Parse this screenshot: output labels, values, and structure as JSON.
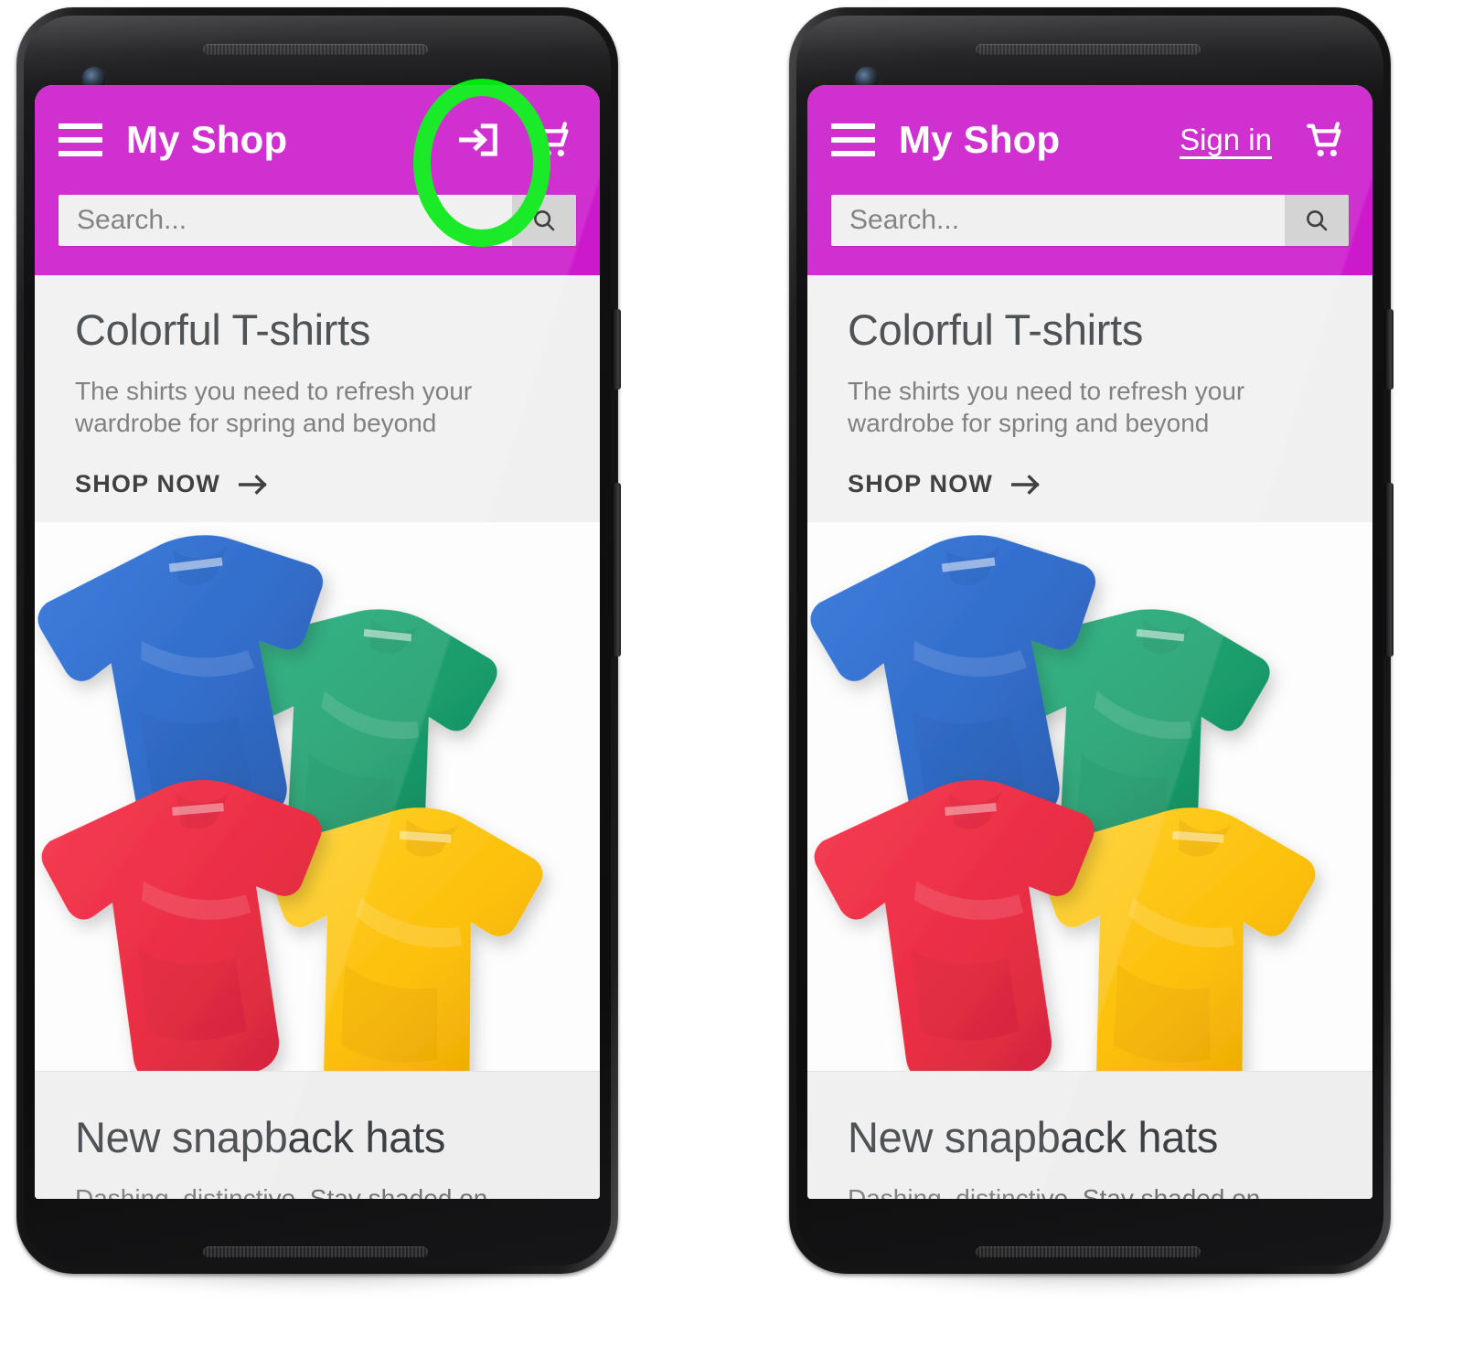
{
  "meta": {
    "accent_magenta": "#cc19cc",
    "highlight_green": "#00e810",
    "screen_bg": "#eeeeee"
  },
  "phones": [
    {
      "id": "left",
      "variant": "icon",
      "appbar": {
        "menu_icon": "hamburger-menu-icon",
        "title": "My Shop",
        "auth_icon": "login-arrow-icon",
        "auth_label": "",
        "cart_icon": "shopping-cart-icon"
      },
      "search": {
        "placeholder": "Search...",
        "value": "",
        "button_icon": "search-icon"
      },
      "hero": {
        "title": "Colorful T-shirts",
        "subtitle": "The shirts you need to refresh your wardrobe for spring and beyond",
        "cta_label": "SHOP NOW",
        "cta_icon": "arrow-right-icon"
      },
      "second_card": {
        "title": "New snapback hats",
        "subtitle": "Dashing, distinctive. Stay shaded on sunny"
      },
      "highlight": "login-arrow-icon"
    },
    {
      "id": "right",
      "variant": "text",
      "appbar": {
        "menu_icon": "hamburger-menu-icon",
        "title": "My Shop",
        "auth_icon": "",
        "auth_label": "Sign in",
        "cart_icon": "shopping-cart-icon"
      },
      "search": {
        "placeholder": "Search...",
        "value": "",
        "button_icon": "search-icon"
      },
      "hero": {
        "title": "Colorful T-shirts",
        "subtitle": "The shirts you need to refresh your wardrobe for spring and beyond",
        "cta_label": "SHOP NOW",
        "cta_icon": "arrow-right-icon"
      },
      "second_card": {
        "title": "New snapback hats",
        "subtitle": "Dashing, distinctive. Stay shaded on sunny"
      },
      "highlight": "sign-in-link"
    }
  ],
  "product_photo": {
    "alt": "Four folded t-shirts",
    "shirts": [
      {
        "color_name": "blue",
        "hex": "#1b5cc4"
      },
      {
        "color_name": "green",
        "hex": "#1a9c6b"
      },
      {
        "color_name": "red",
        "hex": "#e8152f"
      },
      {
        "color_name": "yellow",
        "hex": "#fcc00c"
      }
    ]
  }
}
